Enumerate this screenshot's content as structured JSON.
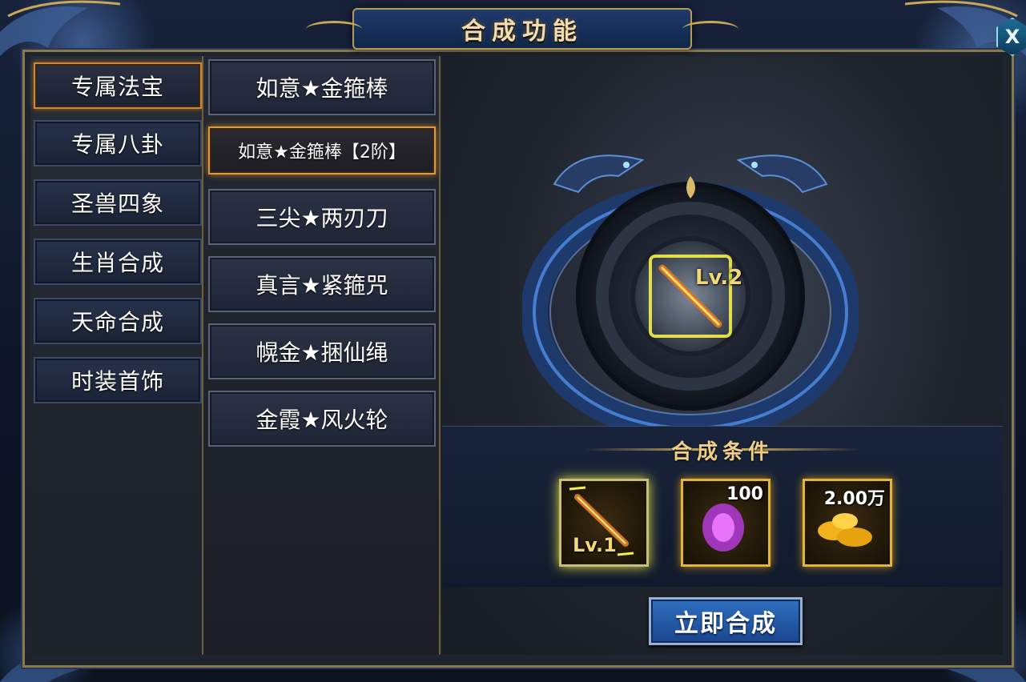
{
  "window": {
    "title": "合成功能",
    "close_label": "X"
  },
  "categories": [
    {
      "label": "专属法宝",
      "active": true
    },
    {
      "label": "专属八卦"
    },
    {
      "label": "圣兽四象"
    },
    {
      "label": "生肖合成"
    },
    {
      "label": "天命合成"
    },
    {
      "label": "时装首饰"
    }
  ],
  "items": [
    {
      "label": "如意★金箍棒"
    },
    {
      "label": "如意★金箍棒【2阶】",
      "active": true
    },
    {
      "label": "三尖★两刃刀"
    },
    {
      "label": "真言★紧箍咒"
    },
    {
      "label": "幌金★捆仙绳"
    },
    {
      "label": "金霞★风火轮"
    }
  ],
  "preview": {
    "level_label": "Lv.2"
  },
  "conditions": {
    "title": "合成条件",
    "materials": [
      {
        "icon": "golden-staff-icon",
        "level_label": "Lv.1"
      },
      {
        "icon": "purple-crystal-icon",
        "count": "100"
      },
      {
        "icon": "gold-ingot-icon",
        "count": "2.00万"
      }
    ]
  },
  "synthesize_button": "立即合成",
  "colors": {
    "accent_gold": "#e2b437",
    "button_blue": "#2f6fc0",
    "active_orange": "#d49a45"
  }
}
